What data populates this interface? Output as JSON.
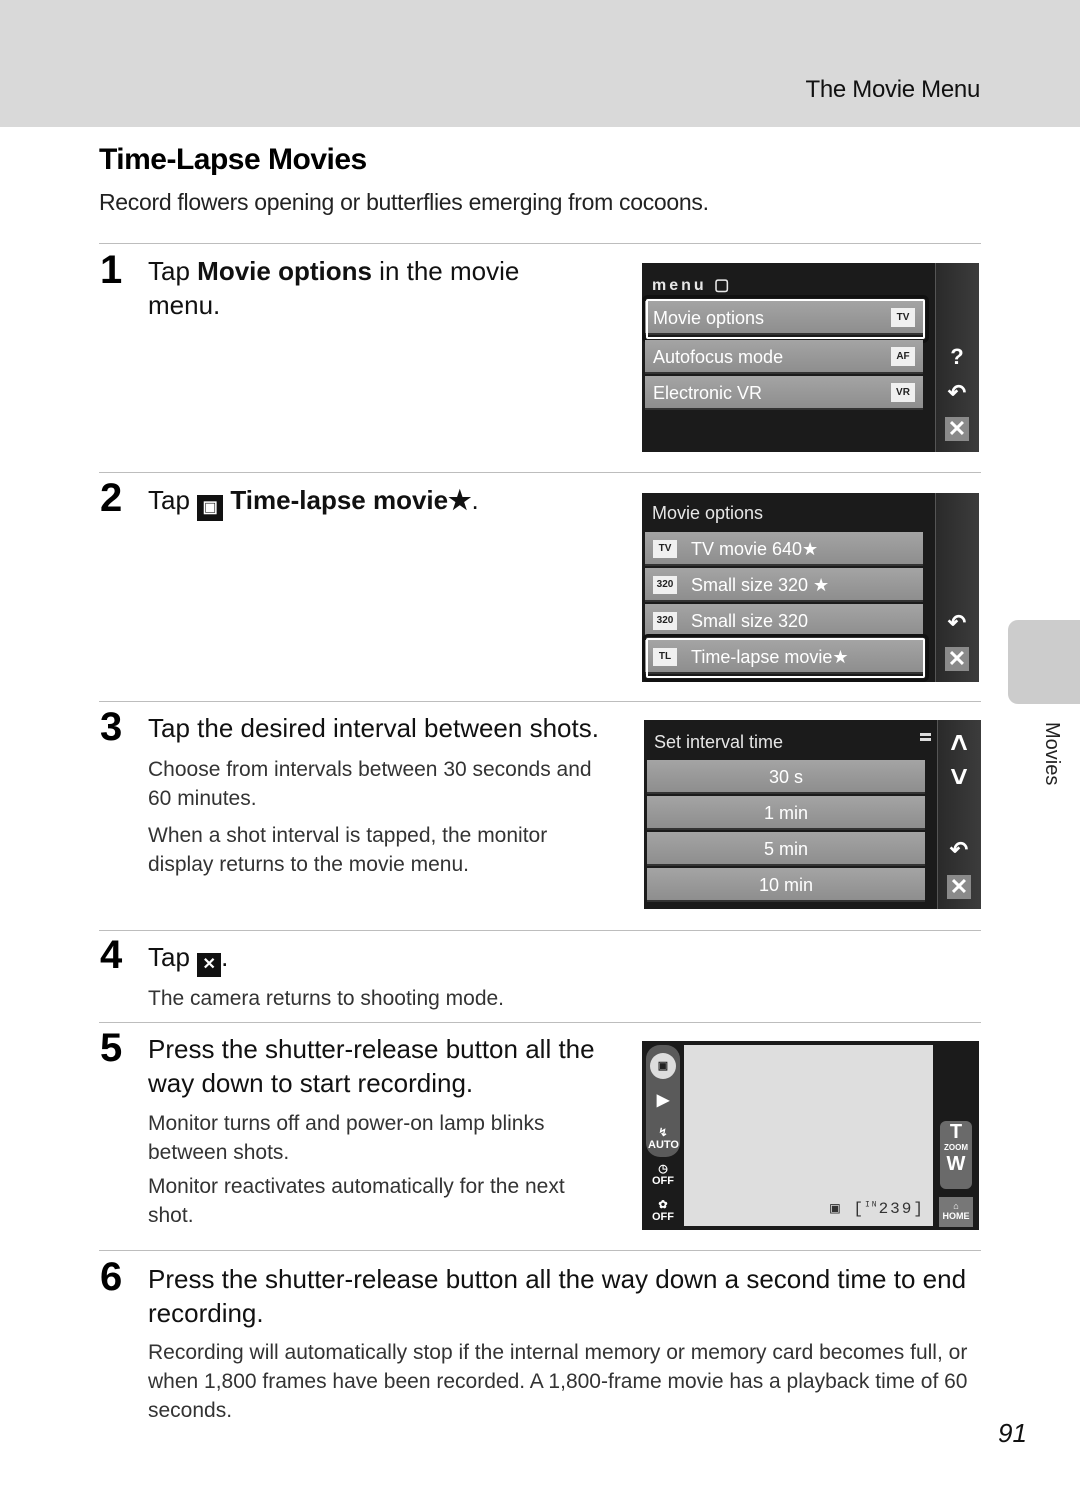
{
  "header": {
    "section": "The Movie Menu"
  },
  "page": {
    "title": "Time-Lapse Movies",
    "intro": "Record flowers opening or butterflies emerging from cocoons.",
    "side_tab": "Movies",
    "number": "91"
  },
  "steps": [
    {
      "num": "1",
      "head_pre": "Tap ",
      "head_bold": "Movie options",
      "head_post": " in the movie menu."
    },
    {
      "num": "2",
      "head_pre": "Tap ",
      "icon": "time-lapse-icon",
      "head_bold": "Time-lapse movie★",
      "head_post": "."
    },
    {
      "num": "3",
      "head": "Tap the desired interval between shots.",
      "body": [
        "Choose from intervals between 30 seconds and 60 minutes.",
        "When a shot interval is tapped, the monitor display returns to the movie menu."
      ]
    },
    {
      "num": "4",
      "head_pre": "Tap ",
      "icon": "close-icon",
      "head_post": ".",
      "body": [
        "The camera returns to shooting mode."
      ]
    },
    {
      "num": "5",
      "head": "Press the shutter-release button all the way down to start recording.",
      "body": [
        "Monitor turns off and power-on lamp blinks between shots.",
        "Monitor reactivates automatically for the next shot."
      ]
    },
    {
      "num": "6",
      "head": "Press the shutter-release button all the way down a second time to end recording.",
      "body": [
        "Recording will automatically stop if the internal memory or memory card becomes full, or when 1,800 frames have been recorded. A 1,800-frame movie has a playback time of 60 seconds."
      ]
    }
  ],
  "screen1": {
    "header": "menu",
    "items": [
      {
        "label": "Movie options",
        "icon": "TV",
        "selected": true
      },
      {
        "label": "Autofocus mode",
        "icon": "AF"
      },
      {
        "label": "Electronic VR",
        "icon": "VR"
      }
    ],
    "side": [
      "help-icon",
      "back-icon",
      "close-icon"
    ]
  },
  "screen2": {
    "header": "Movie options",
    "items": [
      {
        "label": "TV movie 640★",
        "icon": "TV"
      },
      {
        "label": "Small size 320 ★",
        "icon": "320"
      },
      {
        "label": "Small size 320",
        "icon": "320"
      },
      {
        "label": "Time-lapse movie★",
        "icon": "TL",
        "selected": true
      }
    ]
  },
  "screen3": {
    "header": "Set interval time",
    "items": [
      "30 s",
      "1 min",
      "5 min",
      "10 min"
    ]
  },
  "screen4": {
    "left_icons": [
      "movie-mode",
      "playback",
      "AUTO",
      "OFF",
      "OFF"
    ],
    "flash_label": "AUTO",
    "self_timer_label": "OFF",
    "macro_label": "OFF",
    "zoom_t": "T",
    "zoom_label": "ZOOM",
    "zoom_w": "W",
    "home_label": "HOME",
    "exposures_remaining": "239",
    "memory_label": "IN"
  },
  "glyphs": {
    "help": "?",
    "back": "↶",
    "close": "✕",
    "up": "˄",
    "down": "˅",
    "star": "★"
  }
}
